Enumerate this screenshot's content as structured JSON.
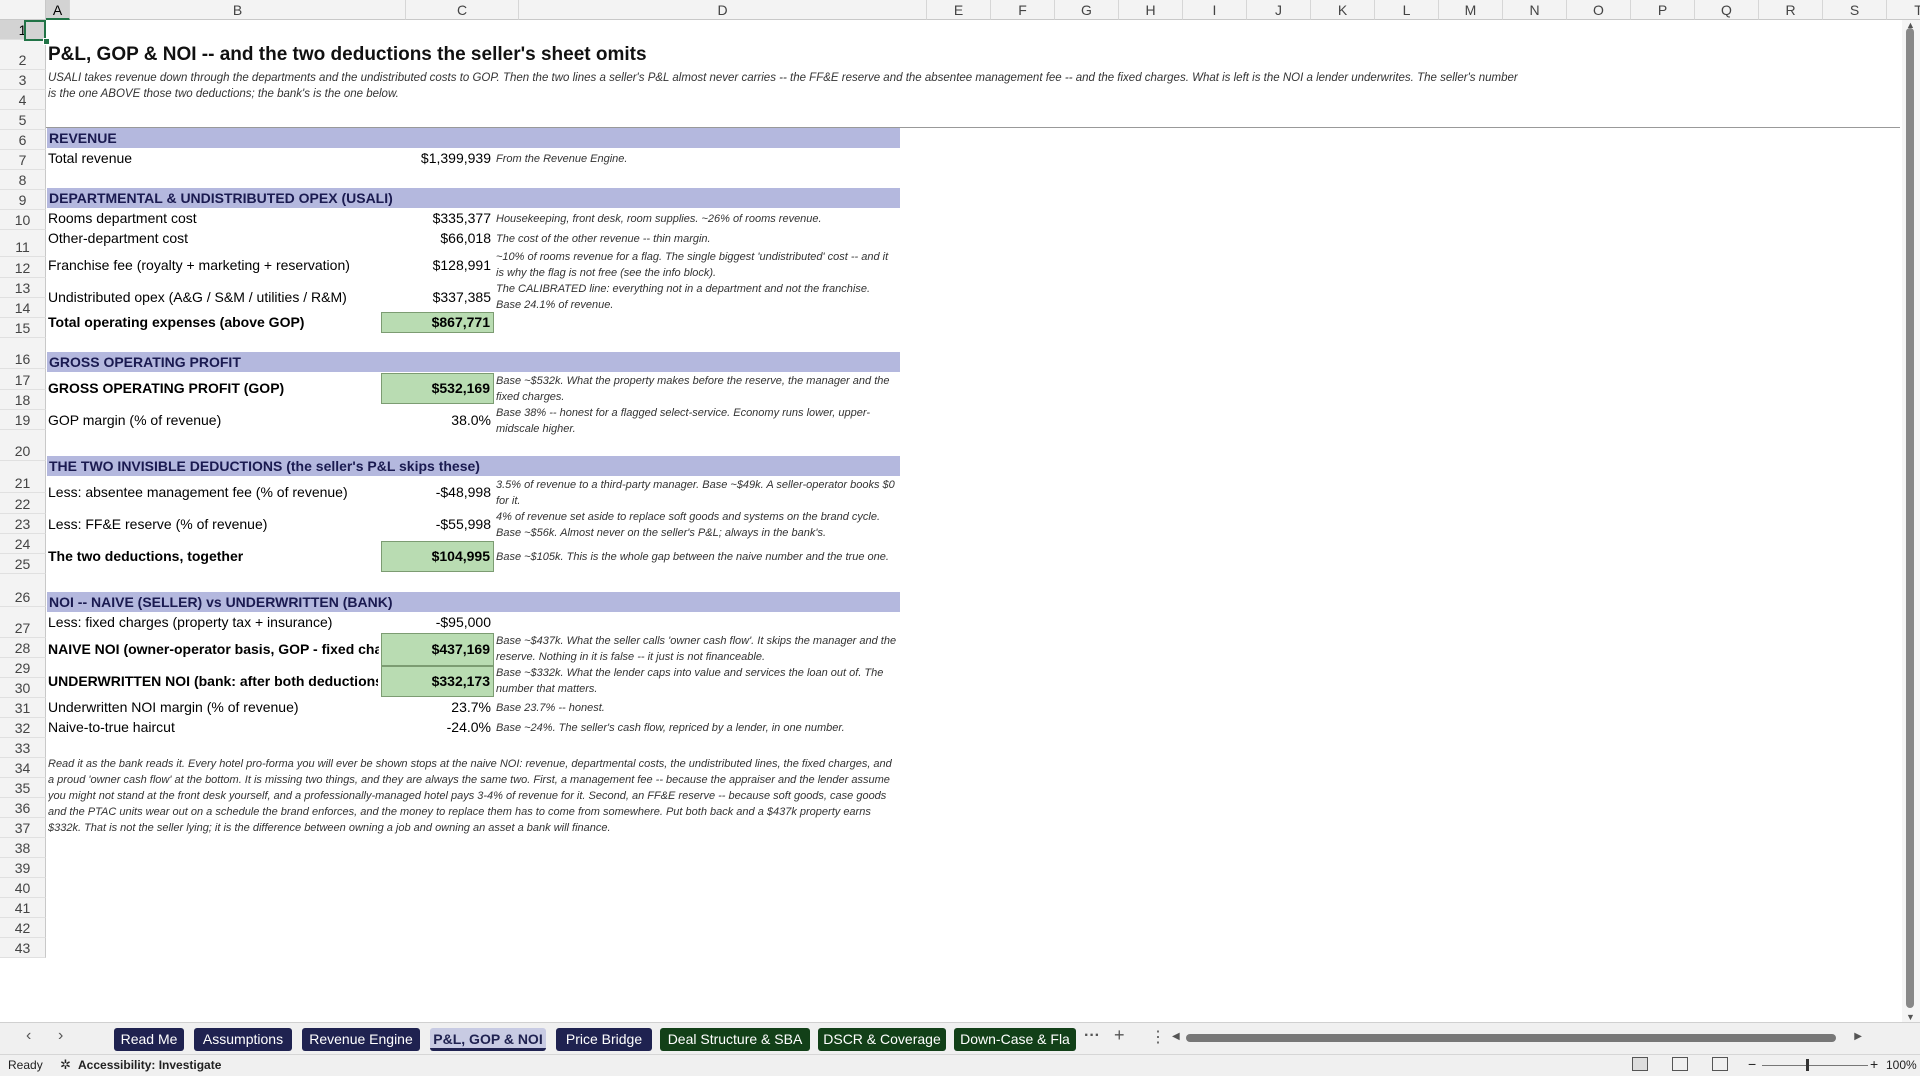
{
  "columns": [
    "A",
    "B",
    "C",
    "D",
    "E",
    "F",
    "G",
    "H",
    "I",
    "J",
    "K",
    "L",
    "M",
    "N",
    "O",
    "P",
    "Q",
    "R",
    "S",
    "T"
  ],
  "rows": [
    "1",
    "2",
    "3",
    "4",
    "5",
    "6",
    "7",
    "8",
    "9",
    "10",
    "11",
    "12",
    "13",
    "14",
    "15",
    "16",
    "17",
    "18",
    "19",
    "20",
    "21",
    "22",
    "23",
    "24",
    "25",
    "26",
    "27",
    "28",
    "29",
    "30",
    "31",
    "32",
    "33",
    "34",
    "35",
    "36",
    "37",
    "38",
    "39",
    "40",
    "41",
    "42",
    "43"
  ],
  "sheet": {
    "title": "P&L, GOP & NOI -- and the two deductions the seller's sheet omits",
    "subtitle": "USALI takes revenue down through the departments and the undistributed costs to GOP. Then the two lines a seller's P&L almost never carries -- the FF&E reserve and the absentee management fee -- and the fixed charges. What is left is the NOI a lender underwrites. The seller's number is the one ABOVE those two deductions; the bank's is the one below.",
    "sections": {
      "revenue": "REVENUE",
      "opex": "DEPARTMENTAL & UNDISTRIBUTED OPEX (USALI)",
      "gop": "GROSS OPERATING PROFIT",
      "deductions": "THE TWO INVISIBLE DEDUCTIONS  (the seller's P&L skips these)",
      "noi": "NOI -- NAIVE (SELLER) vs UNDERWRITTEN (BANK)"
    },
    "lines": {
      "r6": {
        "label": "Total revenue",
        "value": "$1,399,939",
        "note": "From the Revenue Engine."
      },
      "r9": {
        "label": "Rooms department cost",
        "value": "$335,377",
        "note": "Housekeeping, front desk, room supplies. ~26% of rooms revenue."
      },
      "r10": {
        "label": "Other-department cost",
        "value": "$66,018",
        "note": "The cost of the other revenue -- thin margin."
      },
      "r11": {
        "label": "Franchise fee (royalty + marketing + reservation)",
        "value": "$128,991",
        "note": "~10% of rooms revenue for a flag. The single biggest 'undistributed' cost -- and it is why the flag is not free (see the info block)."
      },
      "r12": {
        "label": "Undistributed opex (A&G / S&M / utilities / R&M)",
        "value": "$337,385",
        "note": "The CALIBRATED line: everything not in a department and not the franchise. Base 24.1% of revenue."
      },
      "r13": {
        "label": "Total operating expenses (above GOP)",
        "value": "$867,771"
      },
      "r16": {
        "label": "GROSS OPERATING PROFIT (GOP)",
        "value": "$532,169",
        "note": "Base ~$532k. What the property makes before the reserve, the manager and the fixed charges."
      },
      "r17": {
        "label": "GOP margin (% of revenue)",
        "value": "38.0%",
        "note": "Base 38% -- honest for a flagged select-service. Economy runs lower, upper-midscale higher."
      },
      "r20": {
        "label": "Less: absentee management fee (% of revenue)",
        "value": "-$48,998",
        "note": "3.5% of revenue to a third-party manager. Base ~$49k. A seller-operator books $0 for it."
      },
      "r21": {
        "label": "Less: FF&E reserve (% of revenue)",
        "value": "-$55,998",
        "note": "4% of revenue set aside to replace soft goods and systems on the brand cycle. Base ~$56k. Almost never on the seller's P&L; always in the bank's."
      },
      "r22": {
        "label": "The two deductions, together",
        "value": "$104,995",
        "note": "Base ~$105k. This is the whole gap between the naive number and the true one."
      },
      "r25": {
        "label": "Less: fixed charges (property tax + insurance)",
        "value": "-$95,000"
      },
      "r26": {
        "label": "NAIVE NOI  (owner-operator basis, GOP - fixed charges)",
        "value": "$437,169",
        "note": "Base ~$437k. What the seller calls 'owner cash flow'. It skips the manager and the reserve. Nothing in it is false -- it just is not financeable."
      },
      "r27": {
        "label": "UNDERWRITTEN NOI  (bank: after both deductions)",
        "value": "$332,173",
        "note": "Base ~$332k. What the lender caps into value and services the loan out of. The number that matters."
      },
      "r28": {
        "label": "Underwritten NOI margin (% of revenue)",
        "value": "23.7%",
        "note": "Base 23.7% -- honest."
      },
      "r29": {
        "label": "Naive-to-true haircut",
        "value": "-24.0%",
        "note": "Base ~24%. The seller's cash flow, repriced by a lender, in one number."
      }
    },
    "closing": "Read it as the bank reads it. Every hotel pro-forma you will ever be shown stops at the naive NOI: revenue, departmental costs, the undistributed lines, the fixed charges, and a proud 'owner cash flow' at the bottom. It is missing two things, and they are always the same two. First, a management fee -- because the appraiser and the lender assume you might not stand at the front desk yourself, and a professionally-managed hotel pays 3-4% of revenue for it. Second, an FF&E reserve -- because soft goods, case goods and the PTAC units wear out on a schedule the brand enforces, and the money to replace them has to come from somewhere. Put both back and a $437k property earns $332k. That is not the seller lying; it is the difference between owning a job and owning an asset a bank will finance."
  },
  "tabs": {
    "items": [
      {
        "label": "Read Me"
      },
      {
        "label": "Assumptions"
      },
      {
        "label": "Revenue Engine"
      },
      {
        "label": "P&L, GOP & NOI"
      },
      {
        "label": "Price Bridge"
      },
      {
        "label": "Deal Structure & SBA"
      },
      {
        "label": "DSCR & Coverage"
      },
      {
        "label": "Down-Case & Fla"
      }
    ],
    "more": "···",
    "add": "+",
    "menu": "⋮"
  },
  "status": {
    "ready": "Ready",
    "accessibility": "Accessibility: Investigate",
    "zoom": "100%"
  },
  "colors": {
    "section_band": "#b4b8de",
    "total_fill": "#b9dcb2",
    "tab_navy": "#1f2250",
    "tab_green": "#124018",
    "excel_green": "#217346"
  }
}
